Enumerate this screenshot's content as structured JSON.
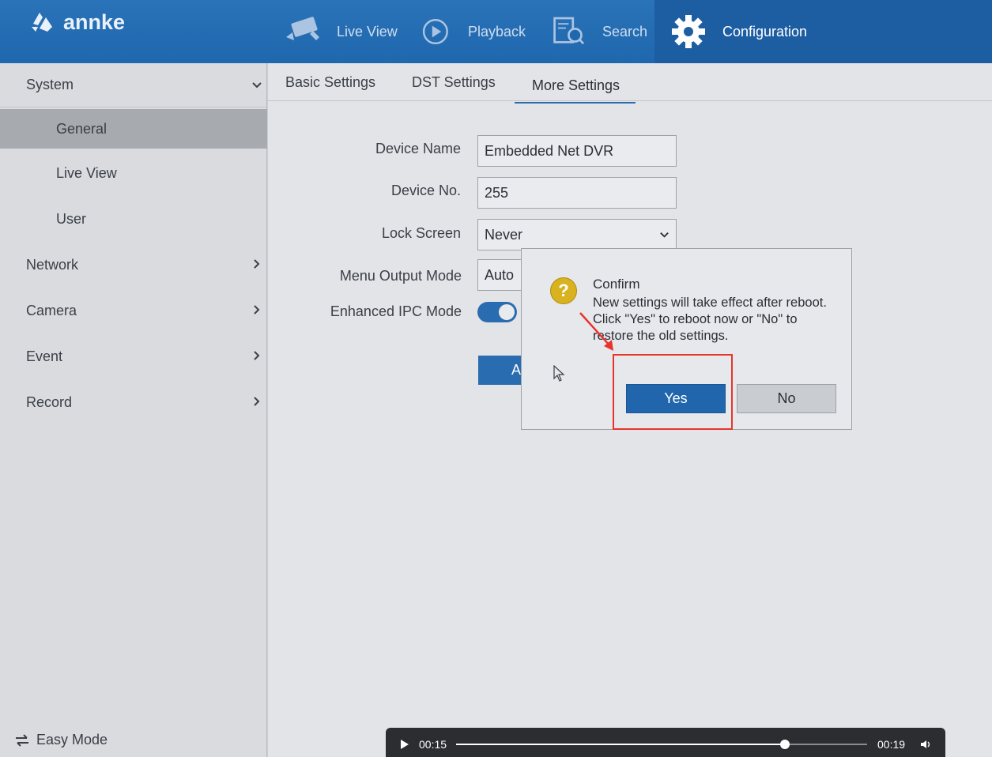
{
  "brand": {
    "logo_text": "annke"
  },
  "nav": {
    "live_view": "Live View",
    "playback": "Playback",
    "search": "Search",
    "configuration": "Configuration"
  },
  "sidebar": {
    "system": "System",
    "general": "General",
    "live_view": "Live View",
    "user": "User",
    "network": "Network",
    "camera": "Camera",
    "event": "Event",
    "record": "Record",
    "easy_mode": "Easy Mode"
  },
  "tabs": {
    "basic": "Basic Settings",
    "dst": "DST Settings",
    "more": "More Settings"
  },
  "form": {
    "device_name_label": "Device Name",
    "device_name_value": "Embedded Net DVR",
    "device_no_label": "Device No.",
    "device_no_value": "255",
    "lock_screen_label": "Lock Screen",
    "lock_screen_value": "Never",
    "menu_output_label": "Menu Output Mode",
    "menu_output_value": "Auto",
    "enhanced_ipc_label": "Enhanced IPC Mode",
    "enhanced_ipc_on": true,
    "apply_label": "A"
  },
  "dialog": {
    "icon": "question-icon",
    "icon_glyph": "?",
    "title": "Confirm",
    "message": "New settings will take effect after reboot. Click \"Yes\" to reboot now or \"No\" to restore the old settings.",
    "yes_label": "Yes",
    "no_label": "No"
  },
  "video": {
    "current_time": "00:15",
    "duration": "00:19",
    "progress": 0.8
  },
  "colors": {
    "header": "#2b73b8",
    "accent": "#2166ad",
    "annotation": "#e8342c",
    "warning": "#d9b21f"
  }
}
